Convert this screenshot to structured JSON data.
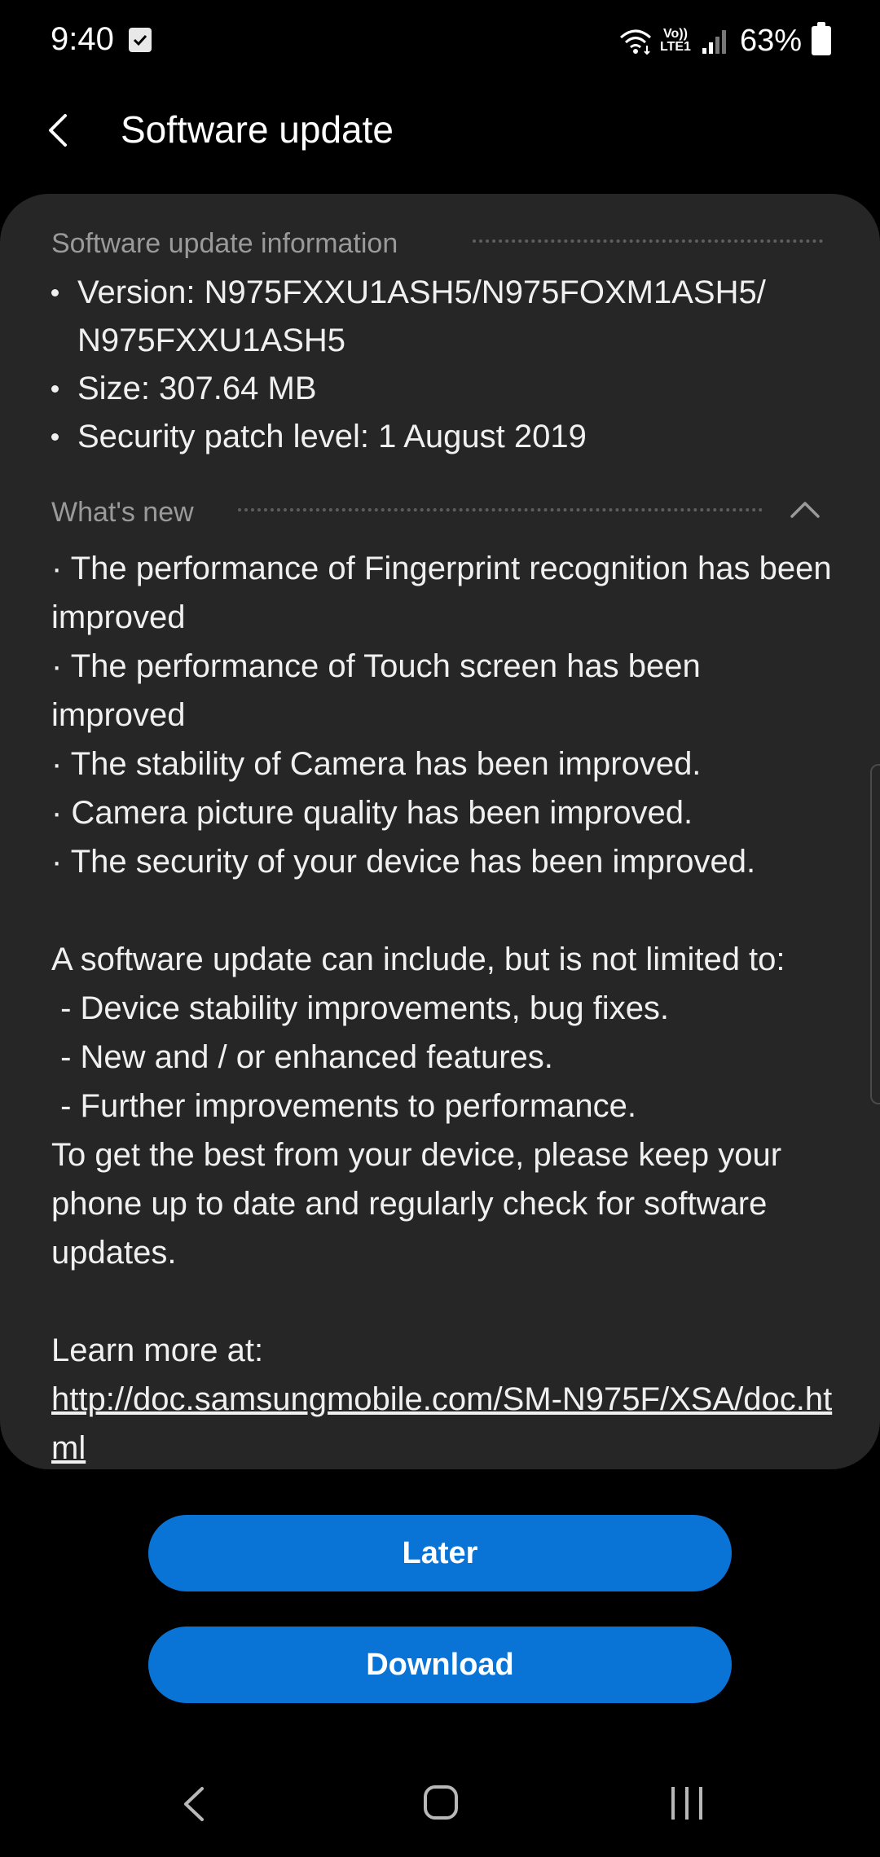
{
  "status_bar": {
    "time": "9:40",
    "volte_line1": "Vo))",
    "volte_line2": "LTE1",
    "battery": "63%"
  },
  "app_bar": {
    "title": "Software update"
  },
  "info_section": {
    "header": "Software update information",
    "items": [
      "Version: N975FXXU1ASH5/N975FOXM1ASH5/ N975FXXU1ASH5",
      "Size: 307.64 MB",
      "Security patch level: 1 August 2019"
    ]
  },
  "whats_new": {
    "header": "What's new",
    "changes": [
      "· The performance of Fingerprint recognition has been improved",
      "· The performance of Touch screen has been improved",
      "· The stability of Camera has been improved.",
      "· Camera picture quality has been improved.",
      "· The security of your device has been improved."
    ],
    "general_intro": "A software update can include, but is not limited to:",
    "general_items": [
      " - Device stability improvements, bug fixes.",
      " - New and / or enhanced features.",
      " - Further improvements to performance."
    ],
    "keep_updated": "To get the best from your device, please keep your phone up to date and regularly check for software updates.",
    "learn_more": "Learn more at:",
    "link": "http://doc.samsungmobile.com/SM-N975F/XSA/doc.html"
  },
  "buttons": {
    "later": "Later",
    "download": "Download"
  },
  "colors": {
    "background": "#000000",
    "card": "#262626",
    "accent": "#0a74d6",
    "secondary_text": "#9a9a9a"
  }
}
